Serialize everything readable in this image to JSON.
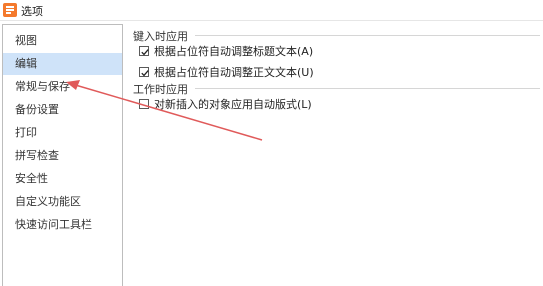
{
  "window": {
    "title": "选项"
  },
  "sidebar": {
    "items": [
      {
        "label": "视图",
        "active": false
      },
      {
        "label": "编辑",
        "active": true
      },
      {
        "label": "常规与保存",
        "active": false
      },
      {
        "label": "备份设置",
        "active": false
      },
      {
        "label": "打印",
        "active": false
      },
      {
        "label": "拼写检查",
        "active": false
      },
      {
        "label": "安全性",
        "active": false
      },
      {
        "label": "自定义功能区",
        "active": false
      },
      {
        "label": "快速访问工具栏",
        "active": false
      }
    ]
  },
  "main": {
    "group1": {
      "title": "键入时应用",
      "options": [
        {
          "label": "根据占位符自动调整标题文本(A)",
          "checked": true
        },
        {
          "label": "根据占位符自动调整正文文本(U)",
          "checked": true
        }
      ]
    },
    "group2": {
      "title": "工作时应用",
      "options": [
        {
          "label": "对新插入的对象应用自动版式(L)",
          "checked": false
        }
      ]
    }
  },
  "colors": {
    "accent": "#cfe3f9",
    "annotation_arrow": "#e05a5a",
    "app_icon": "#f4792c"
  }
}
